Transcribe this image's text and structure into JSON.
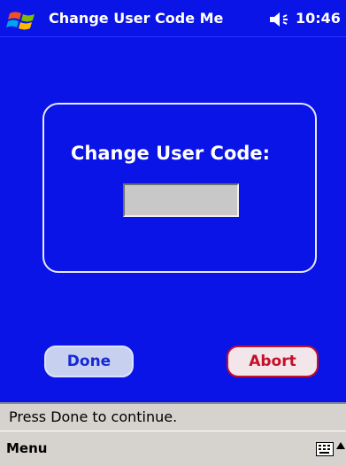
{
  "title_bar": {
    "logo_icon": "windows-logo-icon",
    "title": "Change User Code Me",
    "speaker_icon": "speaker-icon",
    "time": "10:46"
  },
  "dialog": {
    "label": "Change User Code:",
    "code_value": ""
  },
  "buttons": {
    "done_label": "Done",
    "abort_label": "Abort"
  },
  "status_bar": {
    "text": "Press Done to continue."
  },
  "menu_bar": {
    "menu_label": "Menu",
    "keyboard_icon": "keyboard-icon",
    "arrow_icon": "arrow-up-icon"
  },
  "colors": {
    "background": "#0a14e6",
    "done_text": "#1628d8",
    "abort_text": "#c3102a",
    "bar_gray": "#d6d3ce"
  }
}
